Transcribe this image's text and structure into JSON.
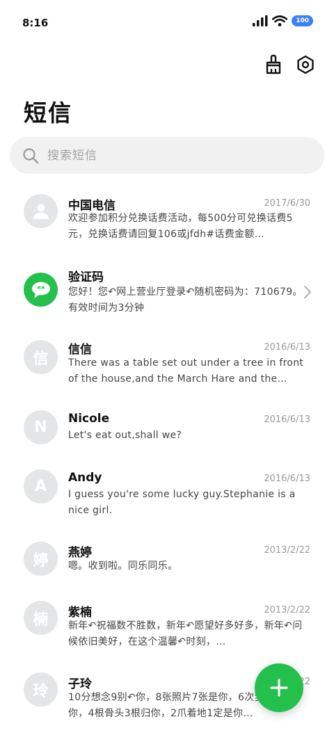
{
  "status": {
    "time": "8:16",
    "battery": "100"
  },
  "header": {
    "title": "短信"
  },
  "search": {
    "placeholder": "搜索短信"
  },
  "messages": [
    {
      "name": "中国电信",
      "date": "2017/6/30",
      "preview": "欢迎参加积分兑换话费活动，每500分可兑换话费5元，兑换话费请回复106或jfdh#话费金额…",
      "avatar": "",
      "avatar_icon": "person-icon"
    },
    {
      "name": "验证码",
      "date": "",
      "preview": "您好！您↶网上营业厅登录↶随机密码为：710679。有效时间为3分钟",
      "avatar": "",
      "avatar_icon": "chat-bubble-icon"
    },
    {
      "name": "信信",
      "date": "2016/6/13",
      "preview": "There was a table set out under a tree in front of the house,and the March Hare and the Hatt…",
      "avatar": "信"
    },
    {
      "name": "Nicole",
      "date": "2016/6/13",
      "preview": "Let's eat out,shall we?",
      "avatar": "N"
    },
    {
      "name": "Andy",
      "date": "2016/6/13",
      "preview": "I guess you're some lucky guy.Stephanie is a nice girl.",
      "avatar": "A"
    },
    {
      "name": "燕婷",
      "date": "2013/2/22",
      "preview": "嗯。收到啦。同乐同乐。",
      "avatar": "婷"
    },
    {
      "name": "紫楠",
      "date": "2013/2/22",
      "preview": "新年↶祝福数不胜数，新年↶愿望好多好多，新年↶问候依旧美好，在这个温馨↶时刻，…",
      "avatar": "楠"
    },
    {
      "name": "子玲",
      "date": "2013/2/22",
      "preview": "10分想念9别↶你，8张照片7张是你，6次梦里5只像你，4根骨头3根归你，2爪着地1定是你…",
      "avatar": "玲"
    }
  ],
  "colors": {
    "accent": "#23c04b",
    "avatar_bg": "#e4e5e7",
    "battery": "#3b82f6"
  }
}
